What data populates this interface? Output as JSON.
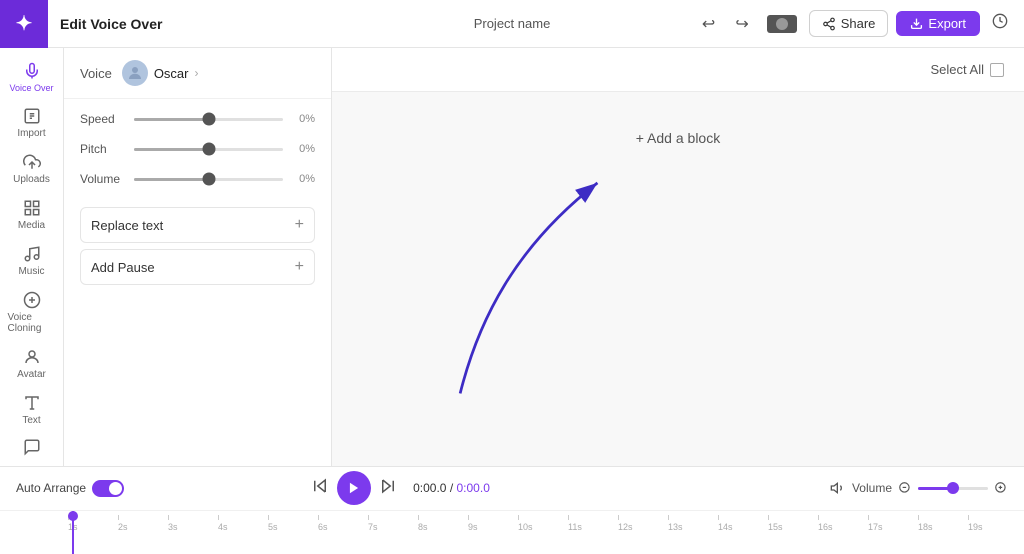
{
  "topbar": {
    "title": "Edit Voice Over",
    "project_name": "Project name",
    "share_label": "Share",
    "export_label": "Export",
    "undo_icon": "↩",
    "redo_icon": "↪",
    "history_icon": "🕐"
  },
  "sidebar": {
    "items": [
      {
        "id": "import",
        "label": "Import",
        "icon": "⬇"
      },
      {
        "id": "uploads",
        "label": "Uploads",
        "icon": "☁"
      },
      {
        "id": "media",
        "label": "Media",
        "icon": "▦"
      },
      {
        "id": "music",
        "label": "Music",
        "icon": "♪"
      },
      {
        "id": "voice-cloning",
        "label": "Voice Cloning",
        "icon": "⊕"
      },
      {
        "id": "avatar",
        "label": "Avatar",
        "icon": "☺"
      },
      {
        "id": "text",
        "label": "Text",
        "icon": "T"
      }
    ],
    "active": "voice-over",
    "active_label": "Voice Over"
  },
  "left_panel": {
    "voice_label": "Voice",
    "voice_name": "Oscar",
    "speed_label": "Speed",
    "speed_value": "0%",
    "pitch_label": "Pitch",
    "pitch_value": "0%",
    "volume_label": "Volume",
    "volume_value": "0%",
    "replace_text_label": "Replace text",
    "add_pause_label": "Add Pause"
  },
  "main_area": {
    "select_all_label": "Select All",
    "add_block_label": "+ Add a block"
  },
  "playback": {
    "auto_arrange_label": "Auto Arrange",
    "time_current": "0:00.0",
    "time_separator": "/",
    "time_total": "0:00.0",
    "volume_label": "Volume"
  },
  "timeline": {
    "marks": [
      "1s",
      "2s",
      "3s",
      "4s",
      "5s",
      "6s",
      "7s",
      "8s",
      "9s",
      "10s",
      "11s",
      "12s",
      "13s",
      "14s",
      "15s",
      "16s",
      "17s",
      "18s",
      "19s"
    ]
  }
}
